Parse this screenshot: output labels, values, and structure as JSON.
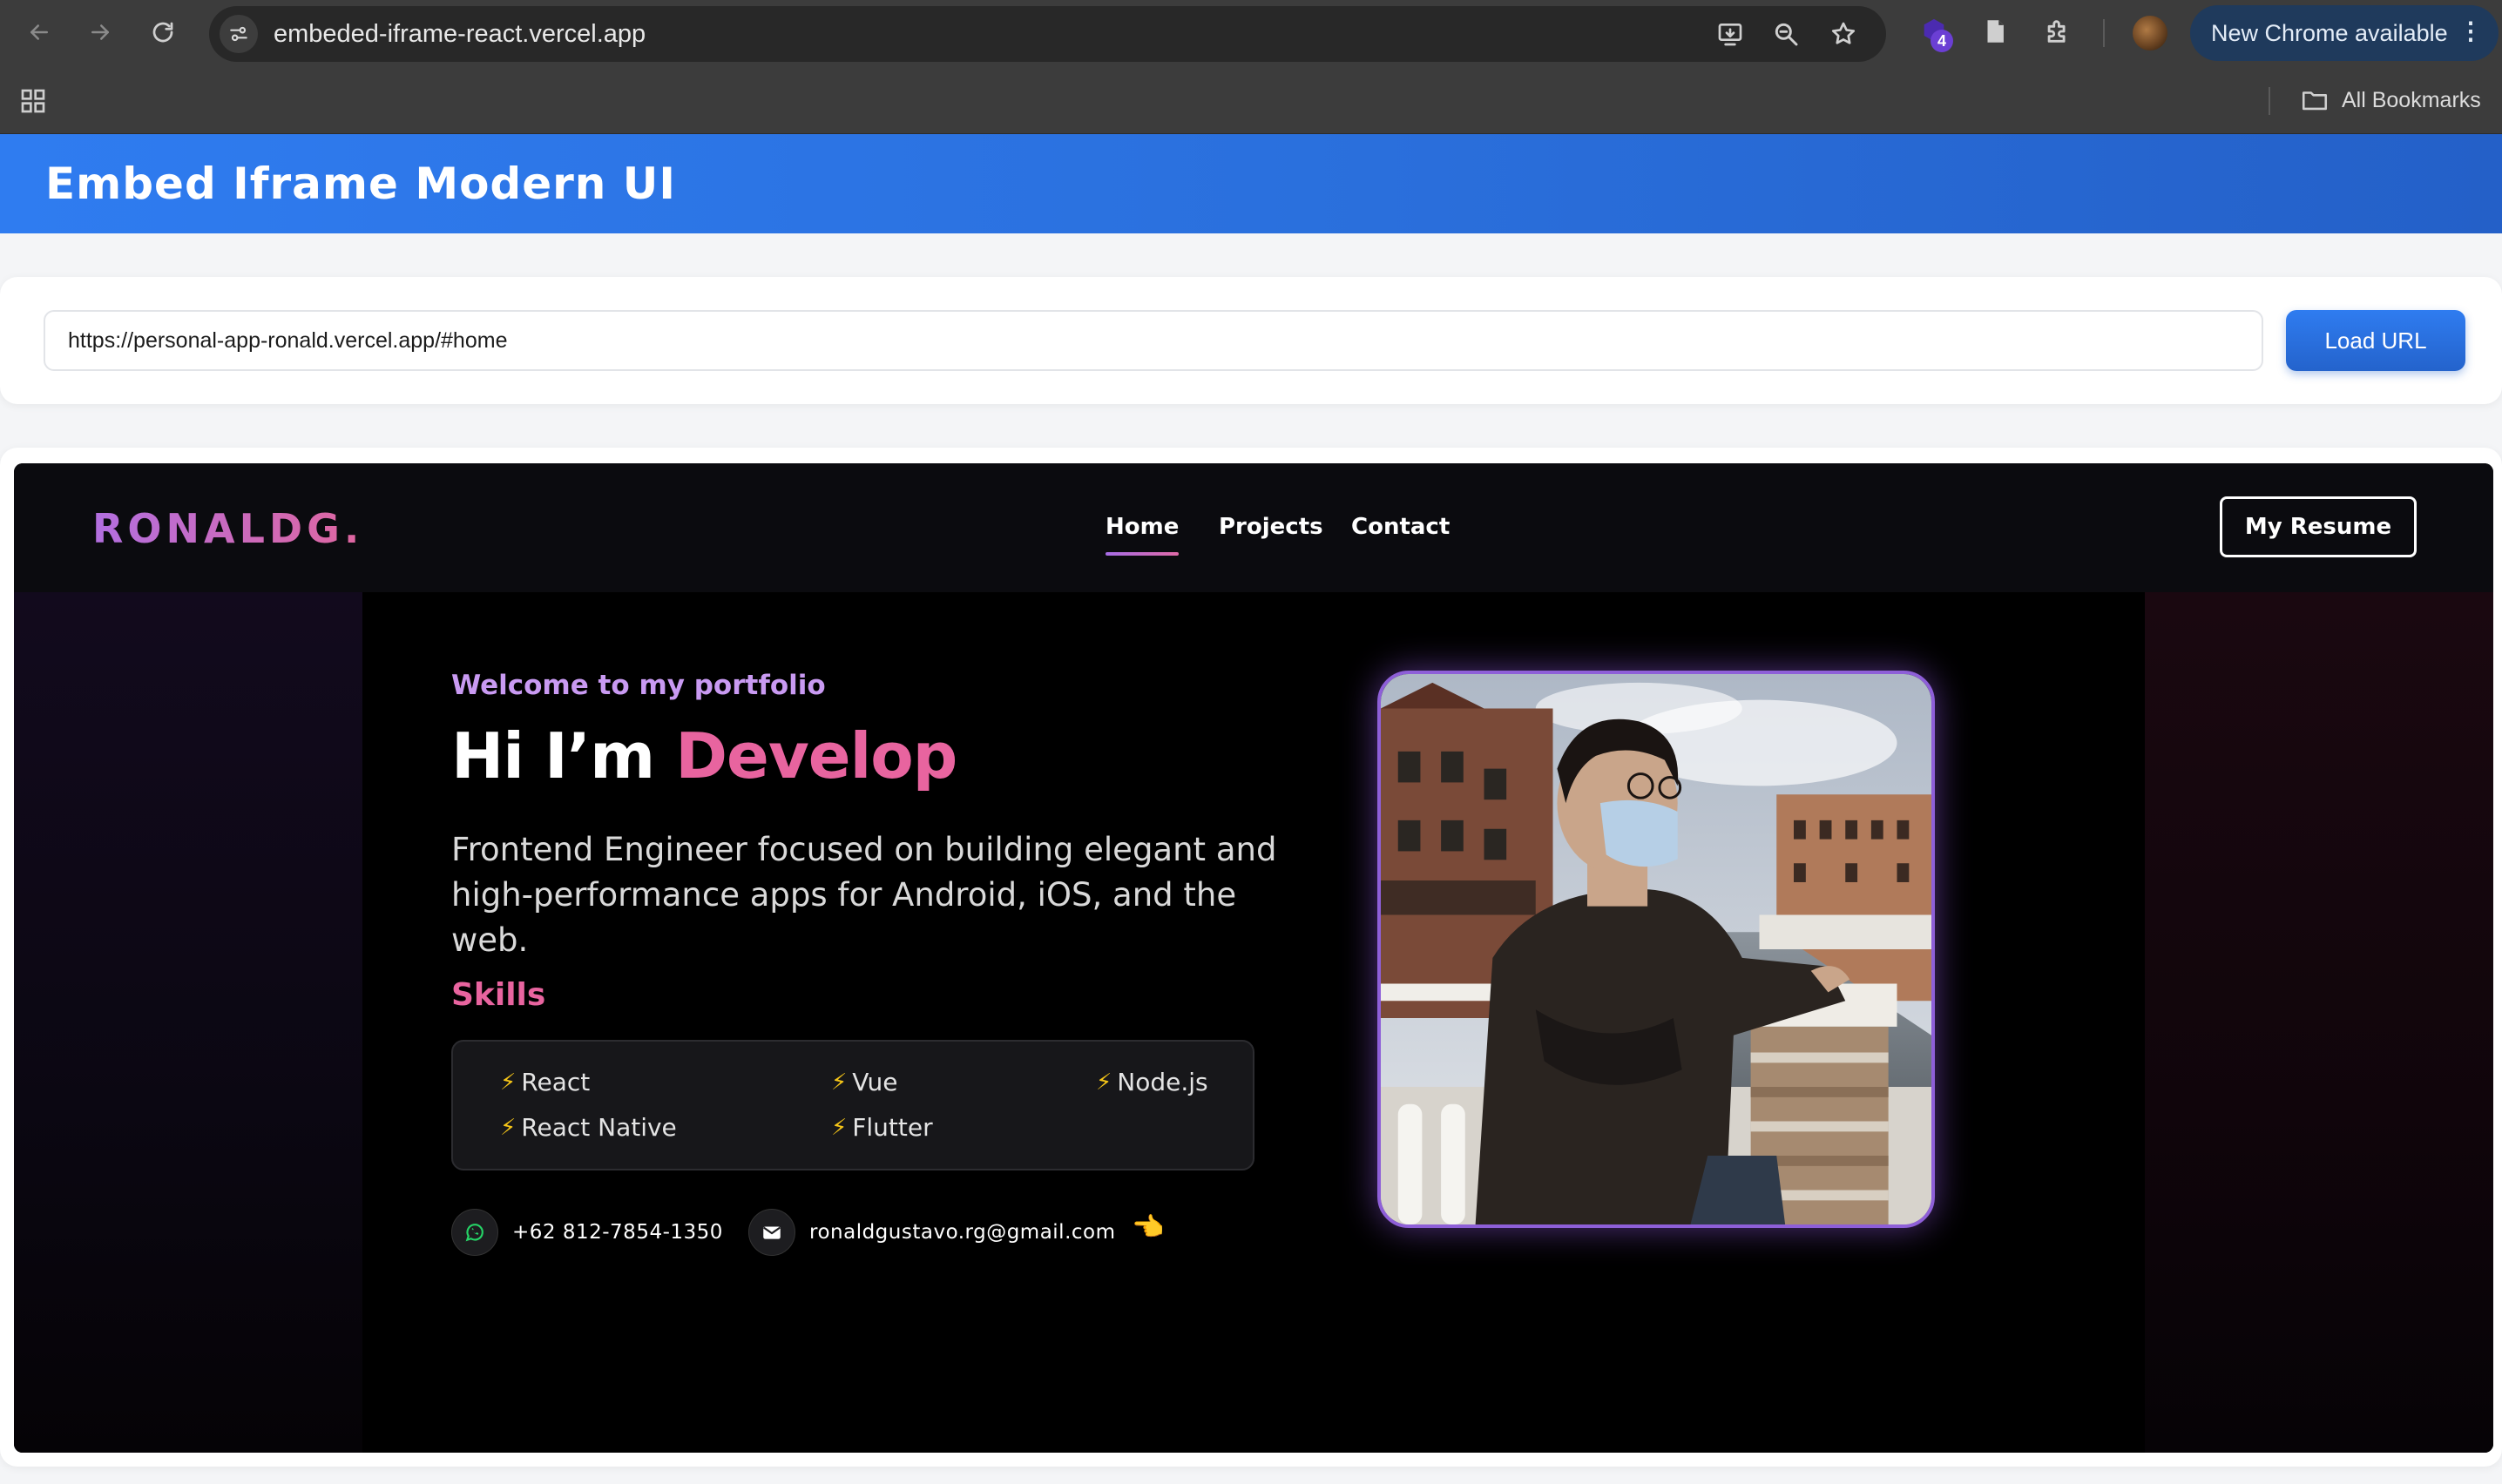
{
  "browser": {
    "url": "embeded-iframe-react.vercel.app",
    "extension_badge": "4",
    "update_label": "New Chrome available",
    "bookmarks_folder": "All Bookmarks"
  },
  "app": {
    "title": "Embed Iframe Modern UI",
    "url_input_value": "https://personal-app-ronald.vercel.app/#home",
    "load_button": "Load URL"
  },
  "site": {
    "logo": "RONALDG.",
    "nav": [
      "Home",
      "Projects",
      "Contact"
    ],
    "active_nav": "Home",
    "resume_button": "My Resume",
    "welcome": "Welcome to my portfolio",
    "greeting": "Hi I’m",
    "greeting_accent": "Develop",
    "description": "Frontend Engineer focused on building elegant and high-performance apps for Android, iOS, and the web.",
    "skills_title": "Skills",
    "skills": [
      "React",
      "Vue",
      "Node.js",
      "React Native",
      "Flutter"
    ],
    "phone": "+62 812-7854-1350",
    "email": "ronaldgustavo.rg@gmail.com",
    "colors": {
      "accent_pink": "#e8649f",
      "accent_purple": "#c99af2",
      "header_blue": "#2f7cf0",
      "chrome_bg": "#3c3c3c"
    }
  }
}
